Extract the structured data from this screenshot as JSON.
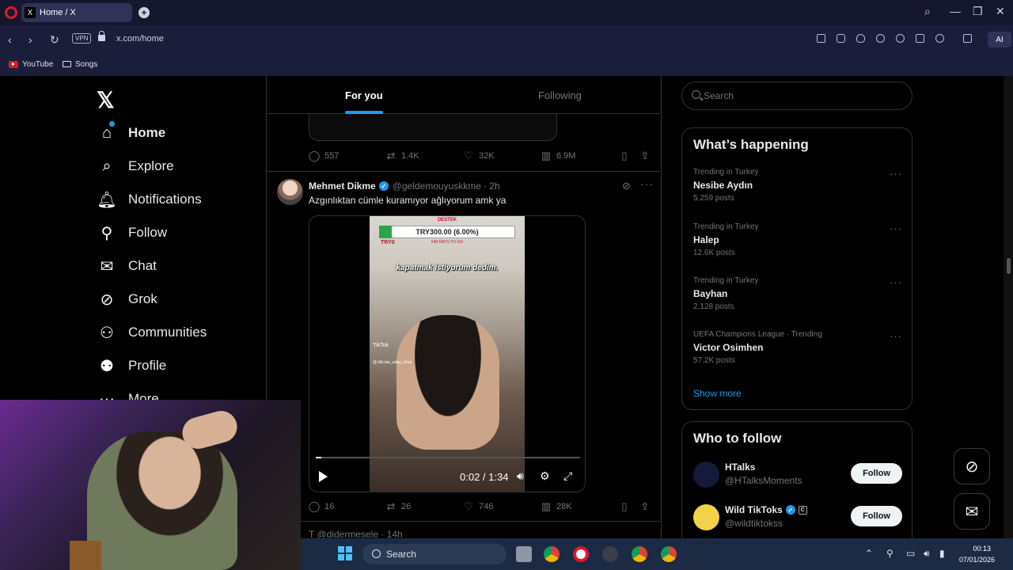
{
  "browser": {
    "tab_title": "Home / X",
    "url": "x.com/home",
    "vpn_label": "VPN",
    "ai_label": "AI",
    "bookmarks": [
      {
        "label": "YouTube",
        "icon": "youtube-icon"
      },
      {
        "label": "Songs",
        "icon": "folder-icon"
      }
    ]
  },
  "sidebar": {
    "logo": "𝕏",
    "items": [
      {
        "label": "Home",
        "icon": "home-icon"
      },
      {
        "label": "Explore",
        "icon": "search-icon"
      },
      {
        "label": "Notifications",
        "icon": "bell-icon"
      },
      {
        "label": "Follow",
        "icon": "person-plus-icon"
      },
      {
        "label": "Chat",
        "icon": "envelope-icon"
      },
      {
        "label": "Grok",
        "icon": "grok-icon"
      },
      {
        "label": "Communities",
        "icon": "communities-icon"
      },
      {
        "label": "Profile",
        "icon": "person-icon"
      },
      {
        "label": "More",
        "icon": "more-circle-icon"
      }
    ]
  },
  "feed": {
    "tabs": [
      "For you",
      "Following"
    ],
    "prev_tweet_actions": {
      "replies": "557",
      "reposts": "1.4K",
      "likes": "32K",
      "views": "6.9M"
    },
    "tweet": {
      "author": "Mehmet Dikme",
      "handle": "@geldemouyuskkme",
      "time": "· 2h",
      "text": "Azgınlıktan cümle kuramıyor ağlıyorum amk ya",
      "video": {
        "top_label": "DESTEK",
        "bar_text": "TRY300.00 (6.00%)",
        "bar_left": "TRY0",
        "bar_sub": "548 DAYS TO GO",
        "caption": "kapatmak istiyorum dedim.",
        "watermark": "TikTok",
        "watermark_handle": "@ kilicdar_aday_olma",
        "time": "0:02 / 1:34",
        "progress": 0.02
      },
      "actions": {
        "replies": "16",
        "reposts": "26",
        "likes": "746",
        "views": "28K"
      }
    },
    "next_tweet_header": "T  @didermesele · 14h"
  },
  "right": {
    "search_placeholder": "Search",
    "happening": {
      "title": "What’s happening",
      "trends": [
        {
          "meta": "Trending in Turkey",
          "name": "Nesibe Aydın",
          "posts": "5,259 posts"
        },
        {
          "meta": "Trending in Turkey",
          "name": "Halep",
          "posts": "12.6K posts"
        },
        {
          "meta": "Trending in Turkey",
          "name": "Bayhan",
          "posts": "2,128 posts"
        },
        {
          "meta": "UEFA Champions League · Trending",
          "name": "Victor Osimhen",
          "posts": "57.2K posts"
        }
      ],
      "show_more": "Show more"
    },
    "who_to_follow": {
      "title": "Who to follow",
      "users": [
        {
          "name": "HTalks",
          "handle": "@HTalksMoments",
          "button": "Follow"
        },
        {
          "name": "Wild TikToks",
          "handle": "@wildtiktokss",
          "button": "Follow",
          "badge": "C"
        }
      ]
    }
  },
  "taskbar": {
    "search_label": "Search",
    "time": "00:13",
    "date": "07/01/2026"
  },
  "colors": {
    "accent": "#1d9bf0",
    "background": "#000000",
    "browser_chrome": "#1b1e3a",
    "taskbar": "#1c2a44"
  }
}
